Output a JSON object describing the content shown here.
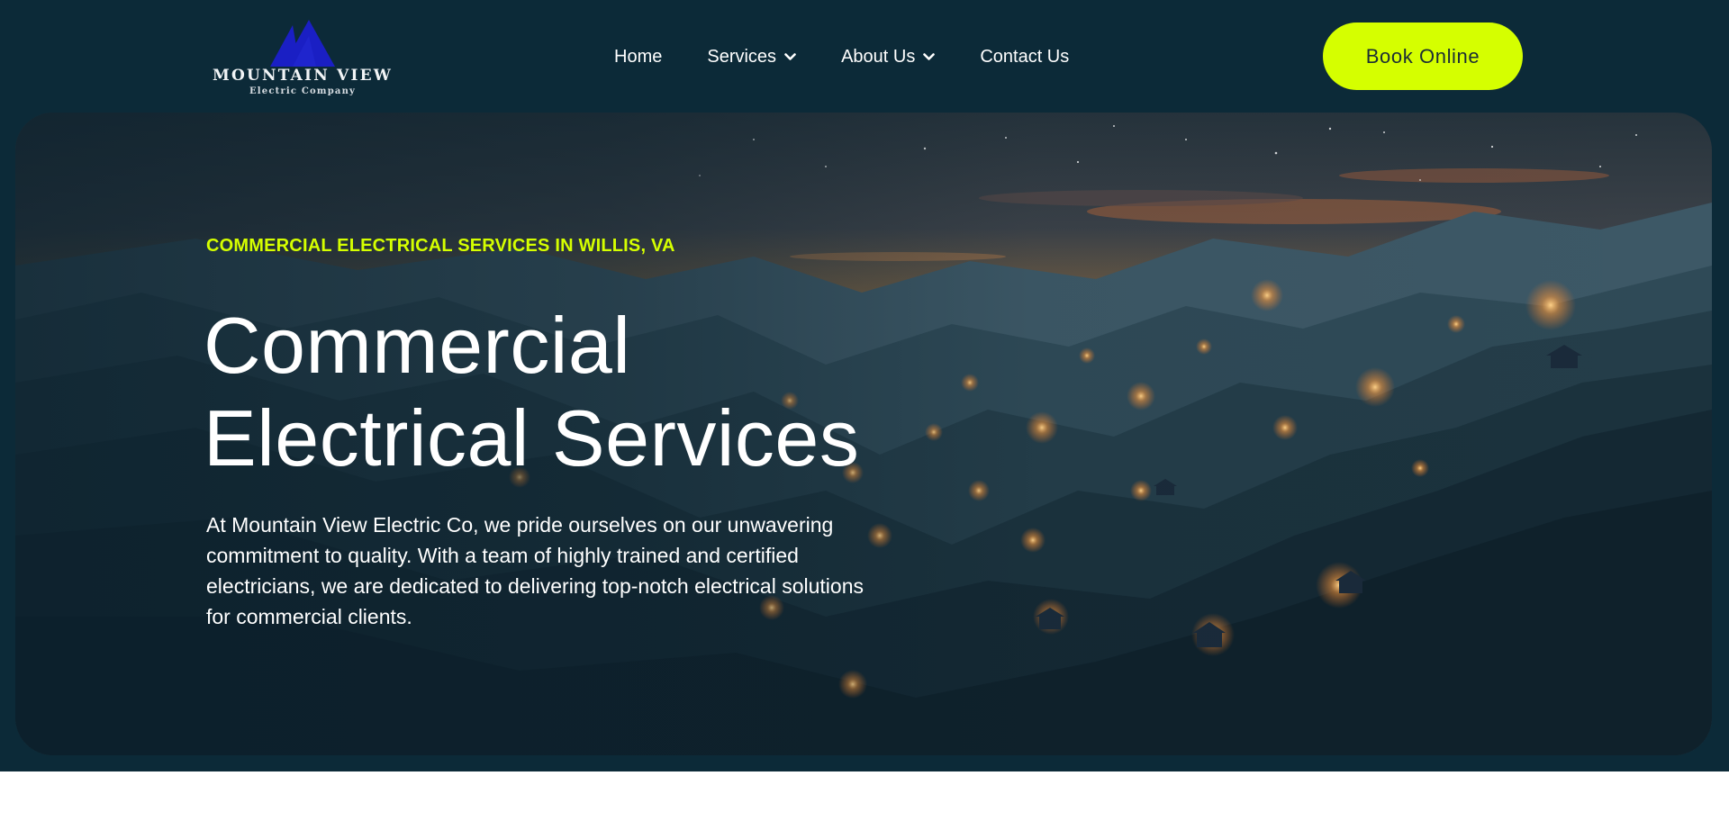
{
  "brand": {
    "name": "MOUNTAIN VIEW",
    "tagline": "Electric Company",
    "logo_icon": "mountain-peaks-icon",
    "logo_color": "#1a1fc4"
  },
  "nav": {
    "items": [
      {
        "label": "Home",
        "has_dropdown": false
      },
      {
        "label": "Services",
        "has_dropdown": true
      },
      {
        "label": "About Us",
        "has_dropdown": true
      },
      {
        "label": "Contact Us",
        "has_dropdown": false
      }
    ],
    "cta_label": "Book Online"
  },
  "hero": {
    "eyebrow": "COMMERCIAL ELECTRICAL SERVICES IN WILLIS, VA",
    "title_line1": "Commercial",
    "title_line2": "Electrical Services",
    "description": "At Mountain View Electric Co, we pride ourselves on our unwavering commitment to quality. With a team of highly trained and certified electricians, we are dedicated to delivering top-notch electrical solutions for commercial clients."
  },
  "colors": {
    "page_background": "#0c2a38",
    "accent": "#d5ff00",
    "text": "#ffffff",
    "below_fold": "#ffffff"
  }
}
